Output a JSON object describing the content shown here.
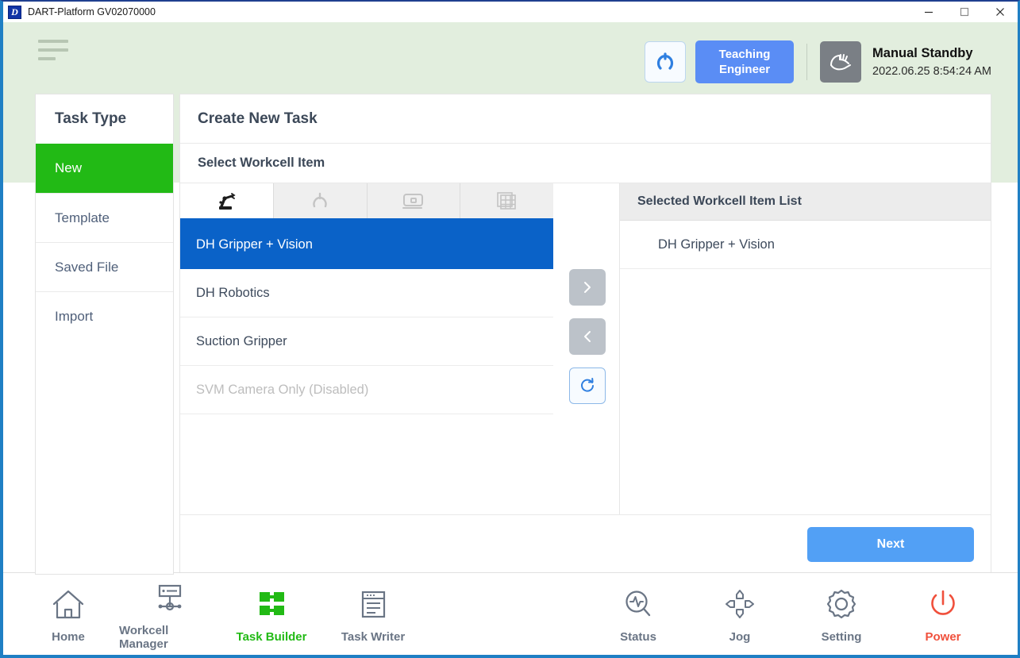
{
  "window": {
    "title": "DART-Platform GV02070000",
    "logo_letter": "D",
    "controls": [
      {
        "name": "minimize",
        "glyph": "minimize-icon"
      },
      {
        "name": "maximize",
        "glyph": "maximize-icon"
      },
      {
        "name": "close",
        "glyph": "close-icon"
      }
    ]
  },
  "header": {
    "menu_icon": "hamburger-icon",
    "gripper_icon": "gripper-icon",
    "teaching_button": {
      "line1": "Teaching",
      "line2": "Engineer"
    },
    "mode_icon": "manual-hand-icon",
    "mode_title": "Manual Standby",
    "timestamp": "2022.06.25 8:54:24 AM",
    "background_color": "#e2eede"
  },
  "sidebar": {
    "title": "Task Type",
    "items": [
      {
        "label": "New",
        "active": true
      },
      {
        "label": "Template",
        "active": false
      },
      {
        "label": "Saved File",
        "active": false
      },
      {
        "label": "Import",
        "active": false
      }
    ],
    "active_color": "#22ba15"
  },
  "main": {
    "title": "Create New Task",
    "subtitle": "Select Workcell Item",
    "tabs": [
      {
        "icon": "robot-arm-icon",
        "active": true
      },
      {
        "icon": "gripper-icon",
        "active": false
      },
      {
        "icon": "camera-icon",
        "active": false
      },
      {
        "icon": "grid-table-icon",
        "active": false
      }
    ],
    "tab_accent_color": "#0a62c8",
    "available_items": [
      {
        "label": "DH Gripper + Vision",
        "selected": true,
        "disabled": false
      },
      {
        "label": "DH Robotics",
        "selected": false,
        "disabled": false
      },
      {
        "label": "Suction Gripper",
        "selected": false,
        "disabled": false
      },
      {
        "label": "SVM Camera Only (Disabled)",
        "selected": false,
        "disabled": true
      }
    ],
    "transfer_buttons": [
      {
        "name": "add-item-button",
        "icon": "chevron-right-icon",
        "style": "gray"
      },
      {
        "name": "remove-item-button",
        "icon": "chevron-left-icon",
        "style": "gray"
      },
      {
        "name": "refresh-button",
        "icon": "refresh-icon",
        "style": "outline"
      }
    ],
    "selected_list_title": "Selected Workcell Item List",
    "selected_items": [
      {
        "label": "DH Gripper + Vision"
      }
    ],
    "next_label": "Next",
    "next_color": "#52a0f5"
  },
  "bottom_nav": {
    "left": [
      {
        "label": "Home",
        "icon": "home-icon",
        "state": "normal"
      },
      {
        "label": "Workcell Manager",
        "icon": "workcell-manager-icon",
        "state": "normal"
      },
      {
        "label": "Task Builder",
        "icon": "task-builder-icon",
        "state": "active"
      },
      {
        "label": "Task Writer",
        "icon": "task-writer-icon",
        "state": "normal"
      }
    ],
    "right": [
      {
        "label": "Status",
        "icon": "status-icon",
        "state": "normal"
      },
      {
        "label": "Jog",
        "icon": "jog-icon",
        "state": "normal"
      },
      {
        "label": "Setting",
        "icon": "gear-icon",
        "state": "normal"
      },
      {
        "label": "Power",
        "icon": "power-icon",
        "state": "danger"
      }
    ],
    "active_color": "#22ba15",
    "danger_color": "#f0503c"
  }
}
